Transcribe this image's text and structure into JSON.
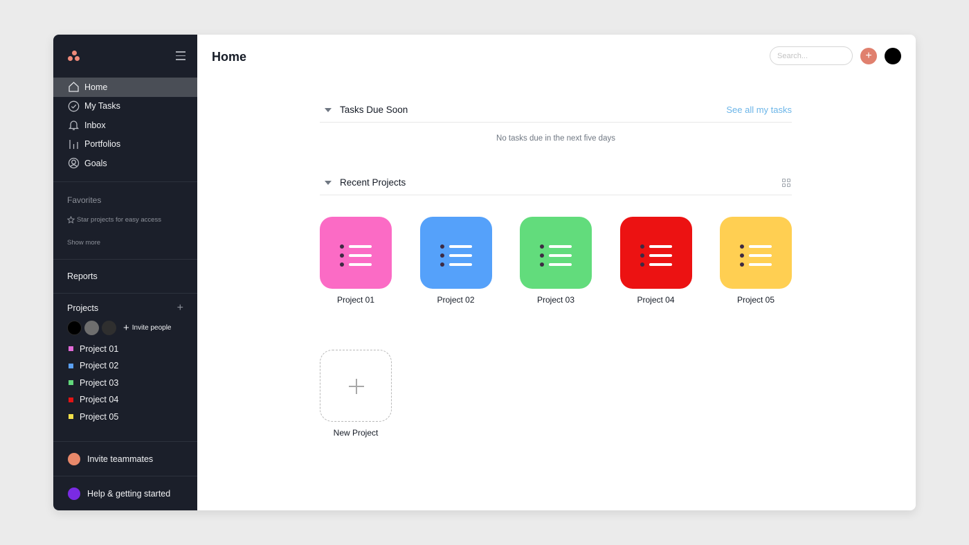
{
  "sidebar": {
    "nav": [
      {
        "label": "Home",
        "icon": "home-icon",
        "active": true
      },
      {
        "label": "My Tasks",
        "icon": "check-circle-icon"
      },
      {
        "label": "Inbox",
        "icon": "bell-icon"
      },
      {
        "label": "Portfolios",
        "icon": "bar-chart-icon"
      },
      {
        "label": "Goals",
        "icon": "person-icon"
      }
    ],
    "favorites": {
      "title": "Favorites",
      "hint": "Star projects for easy access",
      "show_more": "Show more"
    },
    "reports_label": "Reports",
    "projects": {
      "title": "Projects",
      "add_symbol": "+",
      "invite_label": "Invite people",
      "member_colors": [
        "#000000",
        "#6e6e6e",
        "#2f2f2f"
      ],
      "items": [
        {
          "label": "Project 01",
          "color": "#e26ad8"
        },
        {
          "label": "Project 02",
          "color": "#5ba0f2"
        },
        {
          "label": "Project 03",
          "color": "#62d87c"
        },
        {
          "label": "Project 04",
          "color": "#e31414"
        },
        {
          "label": "Project 05",
          "color": "#f2e04a"
        }
      ]
    },
    "bottom": {
      "invite_teammates": "Invite teammates",
      "invite_color": "#e8886a",
      "help": "Help & getting started",
      "help_color": "#7a2be3"
    }
  },
  "header": {
    "title": "Home",
    "search_placeholder": "Search...",
    "add_symbol": "+"
  },
  "tasks_section": {
    "title": "Tasks Due Soon",
    "link": "See all my tasks",
    "empty_text": "No tasks due in the next five days"
  },
  "recent_projects": {
    "title": "Recent Projects",
    "projects": [
      {
        "label": "Project 01",
        "color": "#fb6bc5"
      },
      {
        "label": "Project 02",
        "color": "#55a1fa"
      },
      {
        "label": "Project 03",
        "color": "#62dc7c"
      },
      {
        "label": "Project 04",
        "color": "#ec1212"
      },
      {
        "label": "Project 05",
        "color": "#ffcf52"
      }
    ],
    "new_project_label": "New Project"
  }
}
